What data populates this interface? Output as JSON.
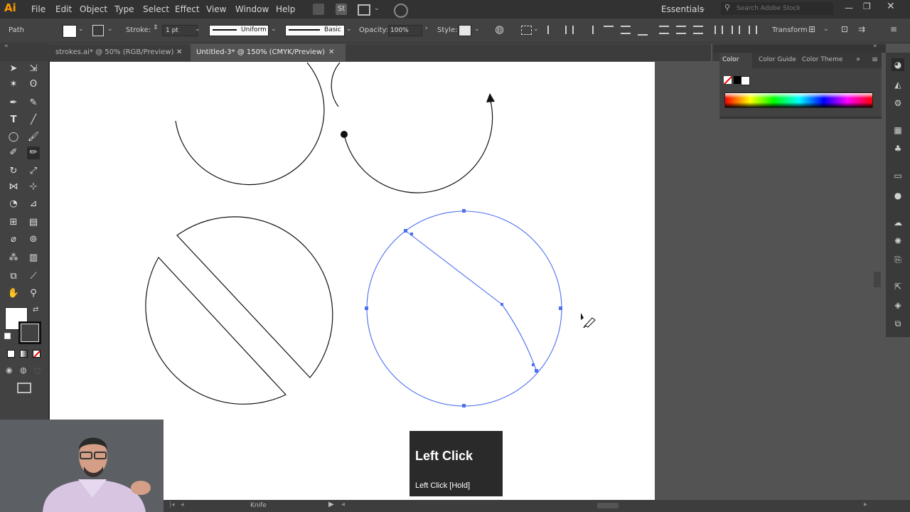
{
  "app": {
    "logo": "Ai"
  },
  "menu": [
    "File",
    "Edit",
    "Object",
    "Type",
    "Select",
    "Effect",
    "View",
    "Window",
    "Help"
  ],
  "menu_extras": {
    "st": "St",
    "workspace": "Essentials",
    "search_placeholder": "Search Adobe Stock"
  },
  "control": {
    "selection_type": "Path",
    "stroke_label": "Stroke:",
    "stroke_weight": "1 pt",
    "profile": "Uniform",
    "brush": "Basic",
    "opacity_label": "Opacity:",
    "opacity_value": "100%",
    "style_label": "Style:",
    "transform_label": "Transform"
  },
  "tabs": [
    {
      "label": "strokes.ai* @ 50% (RGB/Preview)",
      "active": false
    },
    {
      "label": "Untitled-3* @ 150% (CMYK/Preview)",
      "active": true
    }
  ],
  "color_panel": {
    "tabs": [
      "Color",
      "Color Guide",
      "Color Theme"
    ]
  },
  "status": {
    "tool_name": "Knife"
  },
  "overlay": {
    "title": "Left Click",
    "subtitle": "Left Click [Hold]"
  },
  "colors": {
    "selection": "#4a6ff0",
    "logo": "#ff9a00"
  },
  "tool_icons": [
    "selection-tool",
    "direct-selection-tool",
    "magic-wand-tool",
    "lasso-tool",
    "pen-tool",
    "curvature-tool",
    "type-tool",
    "line-tool",
    "ellipse-tool",
    "paintbrush-tool",
    "shaper-tool",
    "pencil-tool",
    "rotate-tool",
    "scale-tool",
    "width-tool",
    "free-transform-tool",
    "shape-builder-tool",
    "perspective-grid-tool",
    "mesh-tool",
    "gradient-tool",
    "eyedropper-tool",
    "blend-tool",
    "symbol-sprayer-tool",
    "column-graph-tool",
    "artboard-tool",
    "slice-tool",
    "hand-tool",
    "zoom-tool"
  ]
}
